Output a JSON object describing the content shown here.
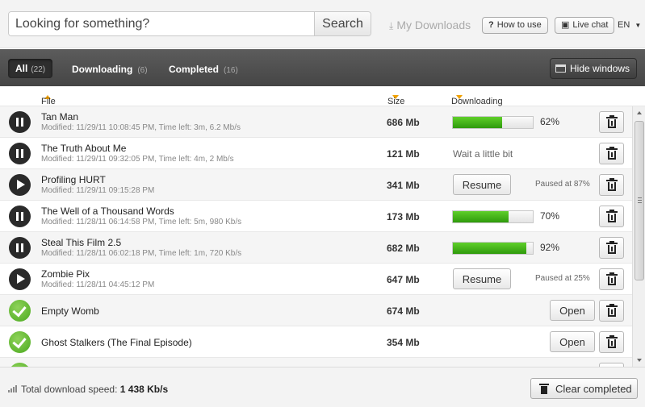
{
  "search": {
    "placeholder": "Looking for something?",
    "button": "Search"
  },
  "header": {
    "my_downloads": "My Downloads",
    "how_to_use": "How to use",
    "live_chat": "Live chat",
    "language": "EN",
    "how_to_use_icon": "?",
    "live_chat_icon": "speech-bubble-icon"
  },
  "tabs": [
    {
      "label": "All",
      "count": "(22)",
      "active": true
    },
    {
      "label": "Downloading",
      "count": "(6)",
      "active": false
    },
    {
      "label": "Completed",
      "count": "(16)",
      "active": false
    }
  ],
  "hide_windows": "Hide windows",
  "columns": {
    "file": "File",
    "size": "Size",
    "downloading": "Downloading"
  },
  "rows": [
    {
      "status": "downloading",
      "name": "Tan Man",
      "meta": "Modified: 11/29/11 10:08:45 PM,  Time left: 3m,  6.2 Mb/s",
      "size": "686 Mb",
      "progress": 62,
      "progress_label": "62%"
    },
    {
      "status": "downloading",
      "name": "The Truth About Me",
      "meta": "Modified: 11/29/11 09:32:05 PM,  Time left: 4m,  2 Mb/s",
      "size": "121 Mb",
      "wait_text": "Wait a little bit"
    },
    {
      "status": "paused",
      "name": "Profiling HURT",
      "meta": "Modified: 11/29/11 09:15:28 PM",
      "size": "341 Mb",
      "button": "Resume",
      "paused_text": "Paused at 87%"
    },
    {
      "status": "downloading",
      "name": "The Well of a Thousand Words",
      "meta": "Modified: 11/28/11 06:14:58 PM,  Time left: 5m,  980 Kb/s",
      "size": "173 Mb",
      "progress": 70,
      "progress_label": "70%"
    },
    {
      "status": "downloading",
      "name": "Steal This Film 2.5",
      "meta": "Modified: 11/28/11 06:02:18 PM,  Time left: 1m,  720 Kb/s",
      "size": "682 Mb",
      "progress": 92,
      "progress_label": "92%"
    },
    {
      "status": "paused",
      "name": "Zombie Pix",
      "meta": "Modified: 11/28/11 04:45:12 PM",
      "size": "647 Mb",
      "button": "Resume",
      "paused_text": "Paused at 25%"
    },
    {
      "status": "completed",
      "name": "Empty Womb",
      "size": "674 Mb",
      "button": "Open"
    },
    {
      "status": "completed",
      "name": "Ghost Stalkers (The Final Episode)",
      "size": "354 Mb",
      "button": "Open"
    }
  ],
  "footer": {
    "speed_label": "Total download speed:",
    "speed_value": "1 438 Kb/s",
    "clear_button": "Clear completed"
  }
}
